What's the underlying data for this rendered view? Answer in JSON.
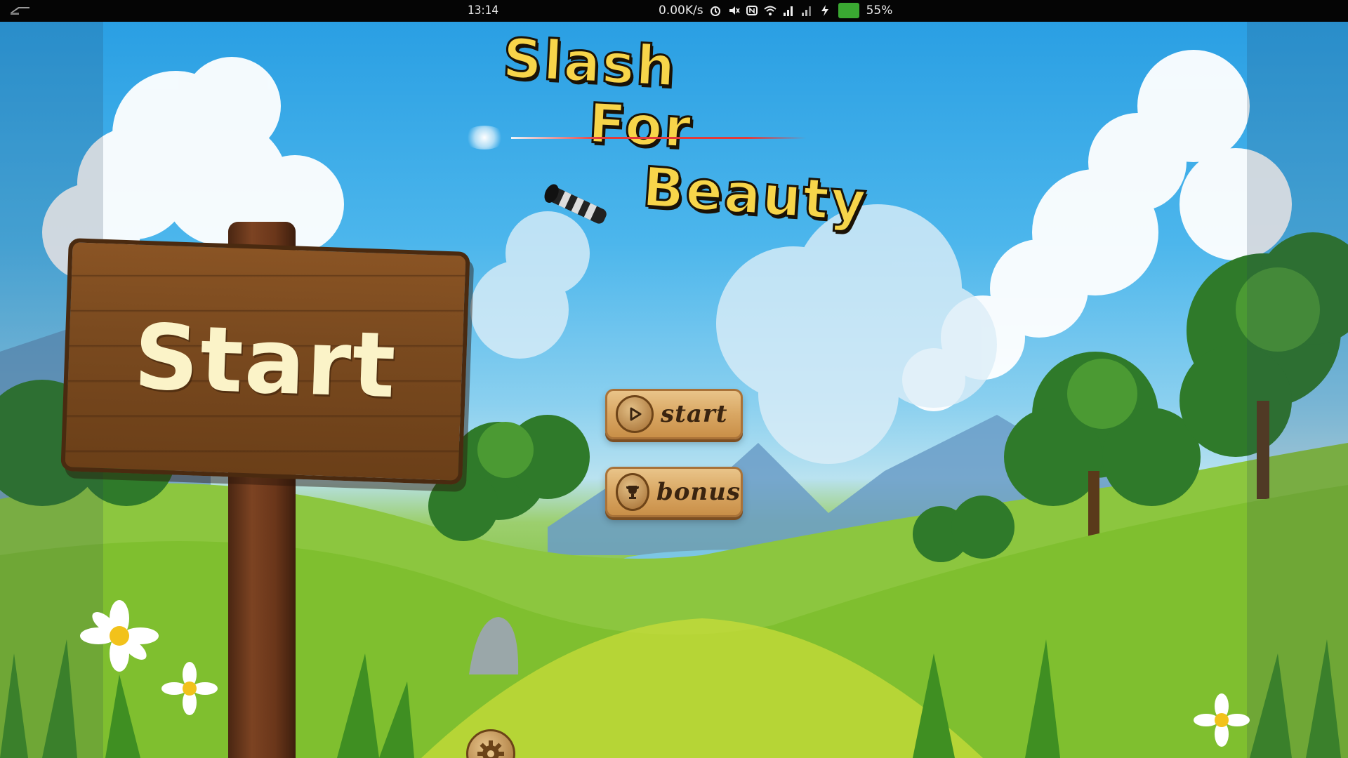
{
  "status_bar": {
    "time": "13:14",
    "data_rate": "0.00K/s",
    "battery_percent": "55%",
    "icons": [
      "back-icon",
      "alarm-icon",
      "mute-icon",
      "nfc-icon",
      "wifi-icon",
      "signal-icon",
      "signal2-icon",
      "charging-icon",
      "battery-icon"
    ]
  },
  "game": {
    "title_line1": "Slash",
    "title_line2": "For",
    "title_line3": "Beauty",
    "sign_text": "Start",
    "menu": {
      "start_label": "start",
      "bonus_label": "bonus"
    },
    "icons": [
      "play-icon",
      "trophy-icon",
      "settings-gear-icon",
      "lightsaber-icon"
    ],
    "colors": {
      "title_fill": "#f7d54a",
      "title_outline": "#1a1206",
      "sign_wood": "#7a4a1f",
      "button_wood": "#d9a763",
      "sky": "#4cb6ec",
      "grass": "#7fbf3a"
    }
  }
}
